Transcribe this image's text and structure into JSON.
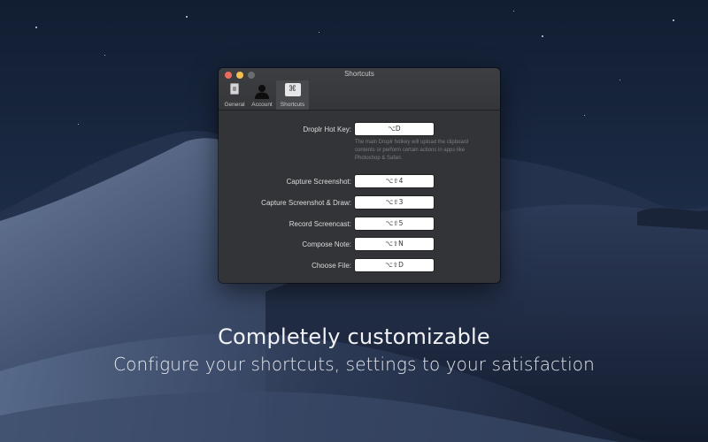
{
  "window": {
    "title": "Shortcuts",
    "tabs": [
      {
        "label": "General",
        "icon": "switch-icon",
        "active": false
      },
      {
        "label": "Account",
        "icon": "person-silhouette-icon",
        "active": false
      },
      {
        "label": "Shortcuts",
        "icon": "command-key-icon",
        "active": true
      }
    ]
  },
  "shortcuts": [
    {
      "label": "Droplr Hot Key:",
      "key": "⌥D"
    },
    {
      "label": "Capture Screenshot:",
      "key": "⌥⇧4"
    },
    {
      "label": "Capture Screenshot & Draw:",
      "key": "⌥⇧3"
    },
    {
      "label": "Record Screencast:",
      "key": "⌥⇧5"
    },
    {
      "label": "Compose Note:",
      "key": "⌥⇧N"
    },
    {
      "label": "Choose File:",
      "key": "⌥⇧D"
    }
  ],
  "hotkey_hint": "The main Droplr hotkey will upload the clipboard contents or perform certain actions in apps like Photoshop & Safari.",
  "caption": {
    "headline": "Completely customizable",
    "subline": "Configure your shortcuts, settings to your satisfaction"
  },
  "colors": {
    "window_bg": "#333437",
    "close": "#ed6a5e",
    "minimize": "#f5bf4f",
    "desktop_sky": "#1b2a44"
  }
}
